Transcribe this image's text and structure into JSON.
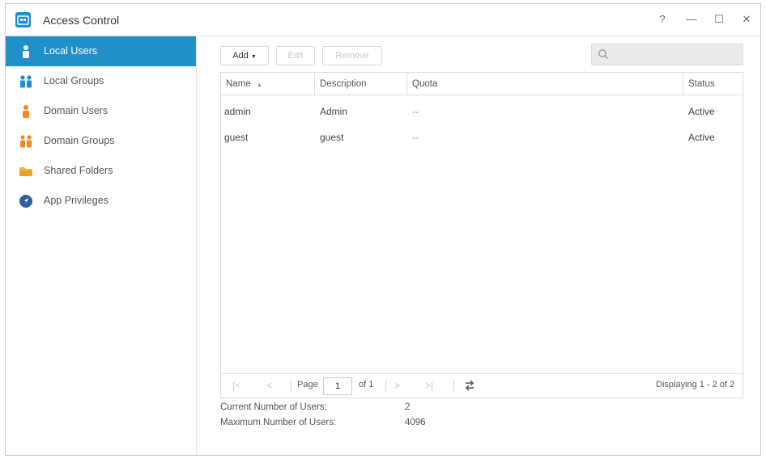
{
  "window": {
    "title": "Access Control",
    "app_icon": "access-control-icon",
    "controls": {
      "help": "?",
      "minimize": "—",
      "maximize": "☐",
      "close": "✕"
    }
  },
  "sidebar": {
    "items": [
      {
        "label": "Local Users",
        "icon": "user-icon",
        "active": true
      },
      {
        "label": "Local Groups",
        "icon": "user-group-icon",
        "active": false
      },
      {
        "label": "Domain Users",
        "icon": "domain-user-icon",
        "active": false
      },
      {
        "label": "Domain Groups",
        "icon": "domain-group-icon",
        "active": false
      },
      {
        "label": "Shared Folders",
        "icon": "folder-icon",
        "active": false
      },
      {
        "label": "App Privileges",
        "icon": "app-privileges-icon",
        "active": false
      }
    ]
  },
  "toolbar": {
    "add_label": "Add",
    "edit_label": "Edit",
    "remove_label": "Remove",
    "search_placeholder": ""
  },
  "table": {
    "columns": [
      "Name",
      "Description",
      "Quota",
      "Status"
    ],
    "sort_indicator": "▲",
    "rows": [
      {
        "name": "admin",
        "description": "Admin",
        "quota": "--",
        "status": "Active"
      },
      {
        "name": "guest",
        "description": "guest",
        "quota": "--",
        "status": "Active"
      }
    ]
  },
  "pager": {
    "page_label": "Page",
    "page_value": "1",
    "of_label": "of 1",
    "display_text": "Displaying 1 - 2 of 2"
  },
  "footer": {
    "current_label": "Current Number of Users:",
    "current_value": "2",
    "max_label": "Maximum Number of Users:",
    "max_value": "4096"
  },
  "colors": {
    "accent": "#1f90c8",
    "orange_icon": "#f08a24",
    "blue_icon": "#1b8fcf"
  }
}
